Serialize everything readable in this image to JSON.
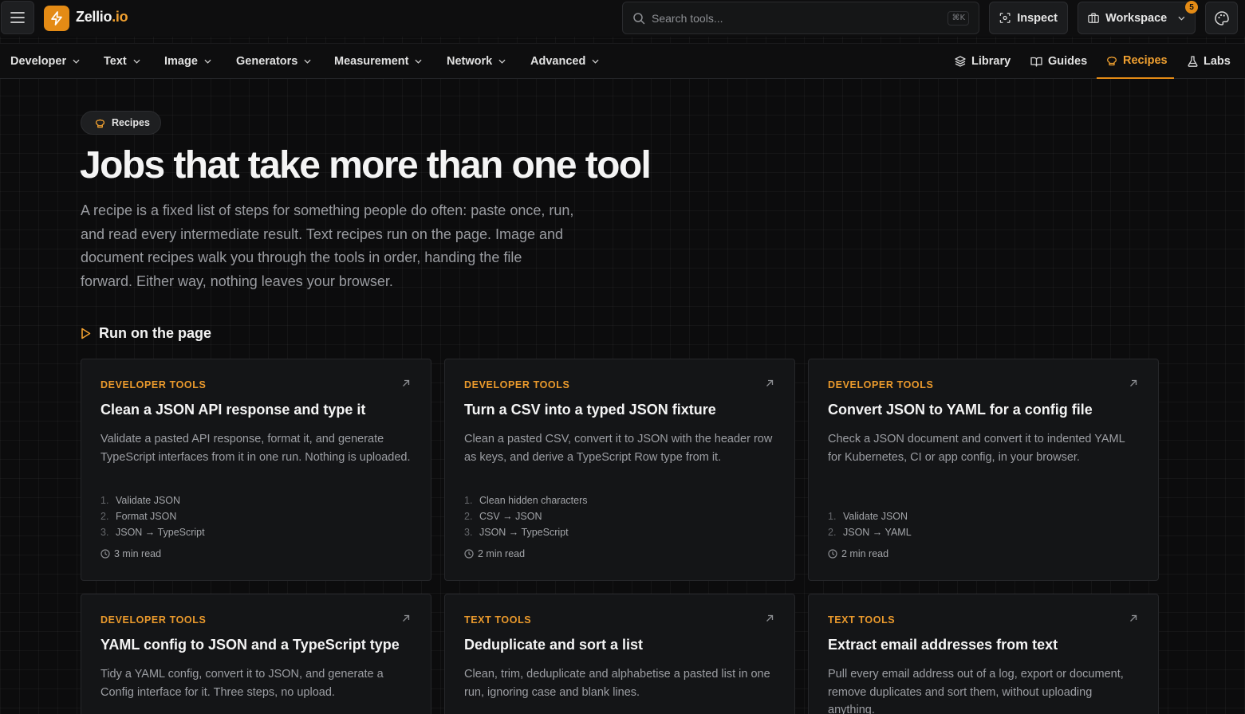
{
  "header": {
    "brand_name": "Zellio",
    "brand_suffix": ".io",
    "search_placeholder": "Search tools...",
    "search_shortcut": "⌘K",
    "inspect_label": "Inspect",
    "workspace_label": "Workspace",
    "workspace_badge": "5",
    "accent_color": "#e48b15"
  },
  "nav": {
    "left": [
      "Developer",
      "Text",
      "Image",
      "Generators",
      "Measurement",
      "Network",
      "Advanced"
    ],
    "right": [
      {
        "label": "Library",
        "icon": "layers-icon"
      },
      {
        "label": "Guides",
        "icon": "book-icon"
      },
      {
        "label": "Recipes",
        "icon": "chef-hat-icon",
        "active": true
      },
      {
        "label": "Labs",
        "icon": "flask-icon"
      }
    ]
  },
  "hero": {
    "pill": "Recipes",
    "title": "Jobs that take more than one tool",
    "description": "A recipe is a fixed list of steps for something people do often: paste once, run, and read every intermediate result. Text recipes run on the page. Image and document recipes walk you through the tools in order, handing the file forward. Either way, nothing leaves your browser."
  },
  "section": {
    "title": "Run on the page"
  },
  "cards": [
    {
      "category": "DEVELOPER TOOLS",
      "title": "Clean a JSON API response and type it",
      "description": "Validate a pasted API response, format it, and generate TypeScript interfaces from it in one run. Nothing is uploaded.",
      "steps": [
        "Validate JSON",
        "Format JSON",
        "JSON → TypeScript"
      ],
      "read_time": "3 min read"
    },
    {
      "category": "DEVELOPER TOOLS",
      "title": "Turn a CSV into a typed JSON fixture",
      "description": "Clean a pasted CSV, convert it to JSON with the header row as keys, and derive a TypeScript Row type from it.",
      "steps": [
        "Clean hidden characters",
        "CSV → JSON",
        "JSON → TypeScript"
      ],
      "read_time": "2 min read"
    },
    {
      "category": "DEVELOPER TOOLS",
      "title": "Convert JSON to YAML for a config file",
      "description": "Check a JSON document and convert it to indented YAML for Kubernetes, CI or app config, in your browser.",
      "steps": [
        "Validate JSON",
        "JSON → YAML"
      ],
      "read_time": "2 min read"
    },
    {
      "category": "DEVELOPER TOOLS",
      "title": "YAML config to JSON and a TypeScript type",
      "description": "Tidy a YAML config, convert it to JSON, and generate a Config interface for it. Three steps, no upload."
    },
    {
      "category": "TEXT TOOLS",
      "title": "Deduplicate and sort a list",
      "description": "Clean, trim, deduplicate and alphabetise a pasted list in one run, ignoring case and blank lines."
    },
    {
      "category": "TEXT TOOLS",
      "title": "Extract email addresses from text",
      "description": "Pull every email address out of a log, export or document, remove duplicates and sort them, without uploading anything."
    }
  ]
}
